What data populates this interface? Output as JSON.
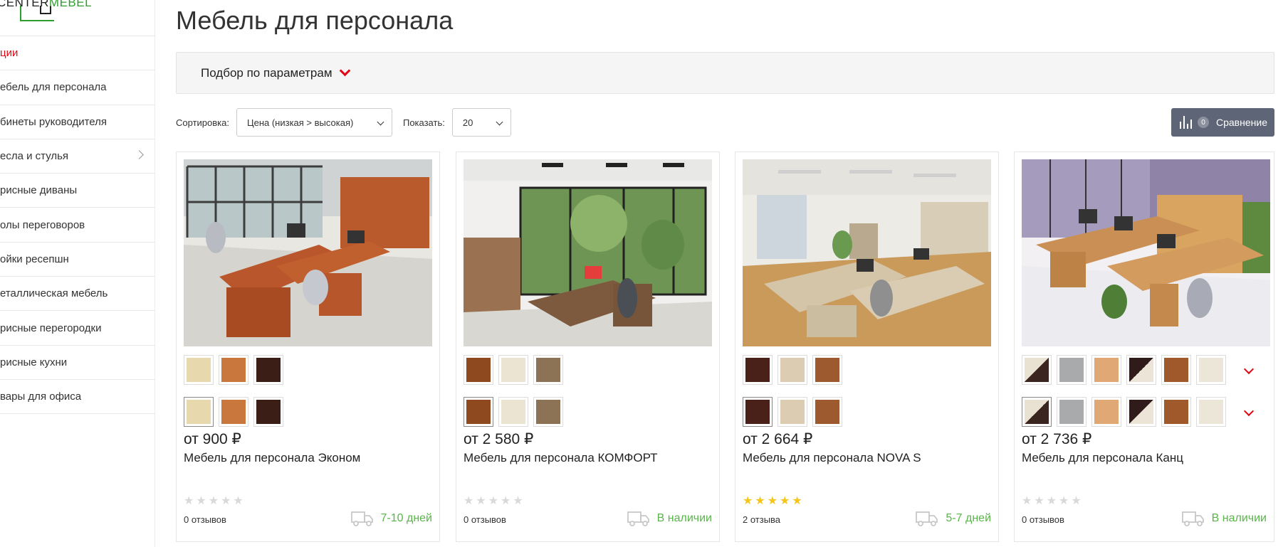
{
  "logo": {
    "part1": "CENTER",
    "part2": "MEBEL"
  },
  "sidebar": {
    "items": [
      {
        "label": "ции",
        "active": true,
        "submenu": false
      },
      {
        "label": "ебель для персонала",
        "active": false,
        "submenu": false
      },
      {
        "label": "бинеты руководителя",
        "active": false,
        "submenu": false
      },
      {
        "label": "есла и стулья",
        "active": false,
        "submenu": true
      },
      {
        "label": "рисные диваны",
        "active": false,
        "submenu": false
      },
      {
        "label": "олы переговоров",
        "active": false,
        "submenu": false
      },
      {
        "label": "ойки ресепшн",
        "active": false,
        "submenu": false
      },
      {
        "label": "еталлическая мебель",
        "active": false,
        "submenu": false
      },
      {
        "label": "рисные перегородки",
        "active": false,
        "submenu": false
      },
      {
        "label": "рисные кухни",
        "active": false,
        "submenu": false
      },
      {
        "label": "вары для офиса",
        "active": false,
        "submenu": false
      }
    ]
  },
  "page": {
    "title": "Мебель для персонала"
  },
  "filter": {
    "label": "Подбор по параметрам"
  },
  "toolbar": {
    "sort_label": "Сортировка:",
    "sort_value": "Цена (низкая > высокая)",
    "show_label": "Показать:",
    "show_value": "20"
  },
  "compare": {
    "count": "0",
    "label": "Сравнение"
  },
  "colors": {
    "accent": "#e30613",
    "in_stock": "#59b44a",
    "compare_bg": "#5d6576",
    "star_on": "#f5c518",
    "star_off": "#d9d9d9"
  },
  "products": [
    {
      "price": "от 900 ₽",
      "name": "Мебель для персонала Эконом",
      "rating": 0,
      "reviews": "0 отзывов",
      "delivery": "7-10 дней",
      "swatches": [
        "#e8d8ae",
        "#c9773d",
        "#3b1f16"
      ],
      "has_more": false
    },
    {
      "price": "от 2 580 ₽",
      "name": "Мебель для персонала КОМФОРТ",
      "rating": 0,
      "reviews": "0 отзывов",
      "delivery": "В наличии",
      "swatches": [
        "#8e4a1e",
        "#ece4d2",
        "#8c7355"
      ],
      "has_more": false
    },
    {
      "price": "от 2 664 ₽",
      "name": "Мебель для персонала NOVA S",
      "rating": 5,
      "reviews": "2 отзыва",
      "delivery": "5-7 дней",
      "swatches": [
        "#4a2119",
        "#dccdb2",
        "#9d5a2e"
      ],
      "has_more": false
    },
    {
      "price": "от 2 736 ₽",
      "name": "Мебель для персонала Канц",
      "rating": 0,
      "reviews": "0 отзывов",
      "delivery": "В наличии",
      "swatches": [
        "split:#e9e1d2:#3b2520",
        "#a9aaab",
        "#e0a874",
        "split:#2f1c1a:#ece4d6",
        "#a0592a",
        "#ece6d8"
      ],
      "has_more": true
    }
  ]
}
